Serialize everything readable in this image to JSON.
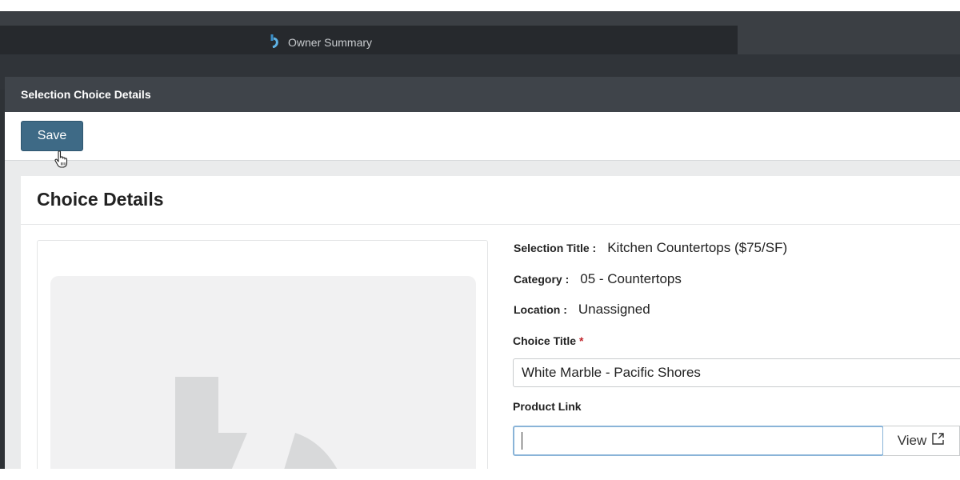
{
  "browser": {
    "tab_title": "Owner Summary"
  },
  "modal": {
    "title": "Selection Choice Details"
  },
  "toolbar": {
    "save_label": "Save"
  },
  "card": {
    "title": "Choice Details"
  },
  "details": {
    "selection_title_label": "Selection Title :",
    "selection_title_value": "Kitchen Countertops ($75/SF)",
    "category_label": "Category :",
    "category_value": "05 - Countertops",
    "location_label": "Location :",
    "location_value": "Unassigned"
  },
  "form": {
    "choice_title_label": "Choice Title",
    "required_marker": "*",
    "choice_title_value": "White Marble - Pacific Shores",
    "product_link_label": "Product Link",
    "product_link_value": "",
    "view_label": "View"
  },
  "icons": {
    "app_logo": "app-logo-icon",
    "view": "external-link-icon",
    "cursor": "hand-pointer-icon",
    "placeholder": "image-placeholder-icon"
  },
  "colors": {
    "save_button": "#3e6a86",
    "modal_header": "#3f444a",
    "required": "#c0242b",
    "focus_border": "#8ab4d8"
  }
}
